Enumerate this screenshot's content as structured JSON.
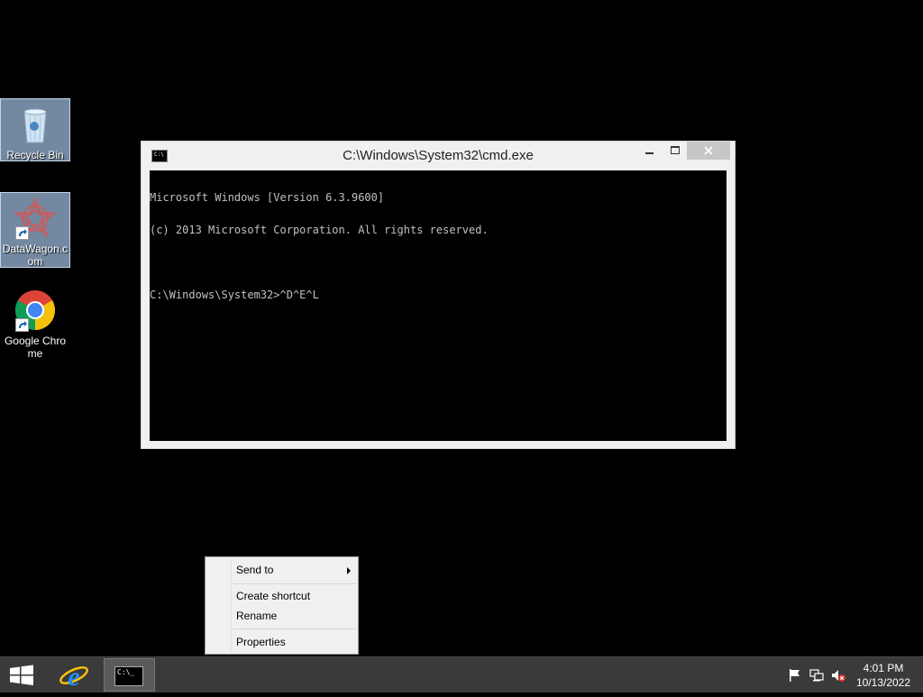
{
  "desktop": {
    "icons": [
      {
        "label": "Recycle Bin"
      },
      {
        "label": "DataWagon.com"
      },
      {
        "label": "Google Chrome"
      }
    ]
  },
  "cmd_window": {
    "title": "C:\\Windows\\System32\\cmd.exe",
    "console_lines": [
      "Microsoft Windows [Version 6.3.9600]",
      "(c) 2013 Microsoft Corporation. All rights reserved.",
      "",
      "C:\\Windows\\System32>^D^E^L"
    ]
  },
  "context_menu": {
    "items": [
      {
        "label": "Send to",
        "submenu": true
      },
      {
        "label": "Create shortcut"
      },
      {
        "label": "Rename"
      },
      {
        "label": "Properties"
      }
    ]
  },
  "taskbar": {
    "cmd_thumb_text": "C:\\_",
    "clock": {
      "time": "4:01 PM",
      "date": "10/13/2022"
    }
  },
  "icons": {
    "tray": [
      "flag-icon",
      "network-icon",
      "volume-muted-icon"
    ]
  },
  "colors": {
    "desktop_bg": "#000000",
    "taskbar_bg": "#3a3a3a",
    "console_text": "#c0c0c0",
    "ie_blue": "#1e90ff",
    "chrome_red": "#db4437",
    "chrome_yellow": "#f4c20d",
    "chrome_green": "#0f9d58",
    "chrome_blue": "#4285f4"
  }
}
